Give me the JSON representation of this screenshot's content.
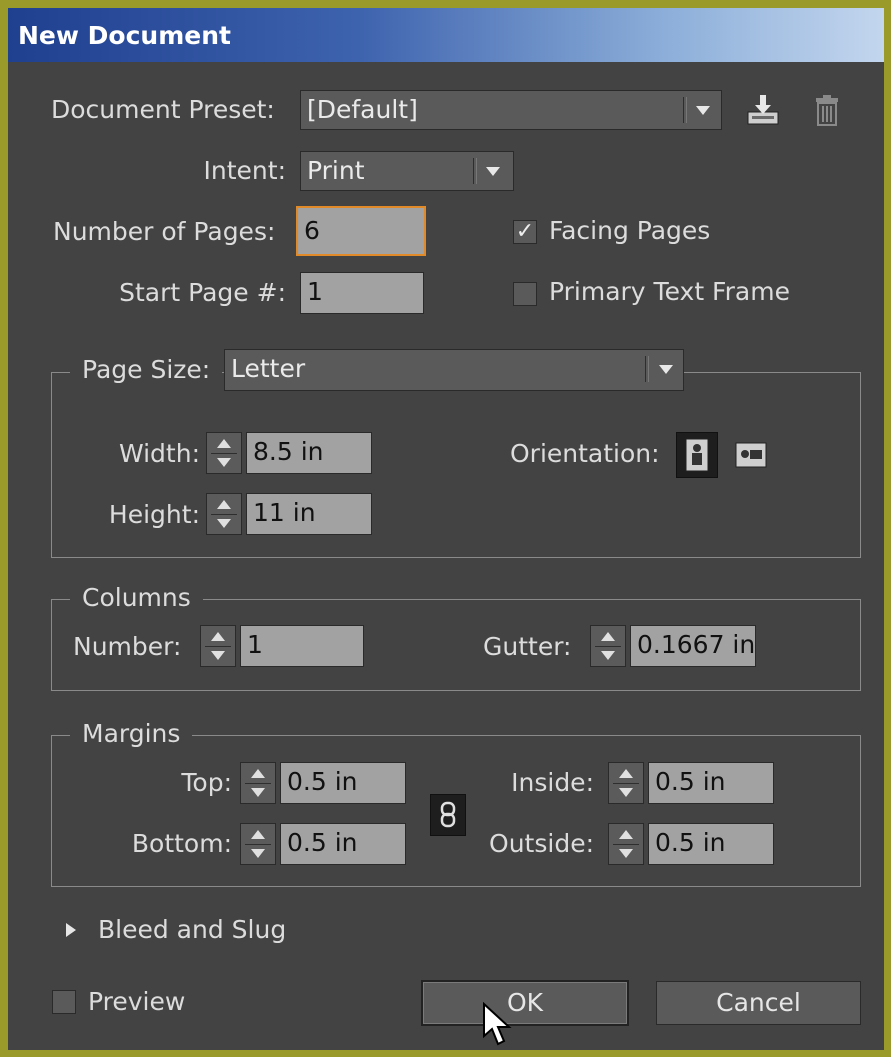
{
  "window": {
    "title": "New Document"
  },
  "preset": {
    "label": "Document Preset:",
    "value": "[Default]"
  },
  "intent": {
    "label": "Intent:",
    "value": "Print"
  },
  "pages": {
    "number_label": "Number of Pages:",
    "number_value": "6",
    "start_label": "Start Page #:",
    "start_value": "1",
    "facing_label": "Facing Pages",
    "facing_checked": true,
    "primary_label": "Primary Text Frame",
    "primary_checked": false
  },
  "page_size": {
    "label": "Page Size:",
    "value": "Letter",
    "width_label": "Width:",
    "width_value": "8.5 in",
    "height_label": "Height:",
    "height_value": "11 in",
    "orientation_label": "Orientation:",
    "orientation_selected": "portrait"
  },
  "columns": {
    "title": "Columns",
    "number_label": "Number:",
    "number_value": "1",
    "gutter_label": "Gutter:",
    "gutter_value": "0.1667 in"
  },
  "margins": {
    "title": "Margins",
    "top_label": "Top:",
    "top_value": "0.5 in",
    "bottom_label": "Bottom:",
    "bottom_value": "0.5 in",
    "inside_label": "Inside:",
    "inside_value": "0.5 in",
    "outside_label": "Outside:",
    "outside_value": "0.5 in"
  },
  "bleed": {
    "label": "Bleed and Slug"
  },
  "footer": {
    "preview_label": "Preview",
    "preview_checked": false,
    "ok_label": "OK",
    "cancel_label": "Cancel"
  },
  "colors": {
    "window_bg": "#434343",
    "field_bg": "#a2a2a2",
    "focus_border": "#e08a2a",
    "title_gradient_start": "#1f3f8f"
  },
  "icons": [
    "save-preset-icon",
    "delete-preset-icon",
    "portrait-orientation-icon",
    "landscape-orientation-icon",
    "link-chain-icon",
    "disclosure-triangle-icon",
    "mouse-cursor-icon"
  ]
}
